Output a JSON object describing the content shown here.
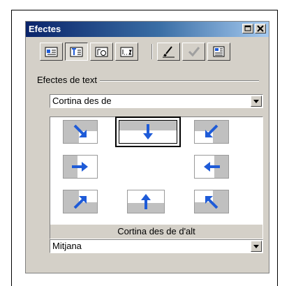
{
  "window": {
    "title": "Efectes"
  },
  "titlebar_buttons": [
    {
      "icon": "minimize-icon"
    },
    {
      "icon": "close-icon"
    }
  ],
  "toolbar": [
    {
      "icon": "slide-transition-icon",
      "pressed": false
    },
    {
      "icon": "text-effects-icon",
      "pressed": true
    },
    {
      "icon": "object-effects-icon",
      "pressed": false
    },
    {
      "icon": "order-icon",
      "pressed": false
    },
    {
      "icon": "preview-brush-icon",
      "pressed": false
    },
    {
      "icon": "apply-check-icon",
      "pressed": false
    },
    {
      "icon": "slideshow-icon",
      "pressed": false
    }
  ],
  "text_effects": {
    "group_label": "Efectes de text",
    "effect_type": "Cortina des de",
    "selected_caption": "Cortina des de d'alt",
    "speed": "Mitjana",
    "directions": [
      {
        "name": "top-left",
        "arrow_icon": "arrow-down-right-icon"
      },
      {
        "name": "top",
        "arrow_icon": "arrow-down-icon",
        "selected": true
      },
      {
        "name": "top-right",
        "arrow_icon": "arrow-down-left-icon"
      },
      {
        "name": "left",
        "arrow_icon": "arrow-right-icon"
      },
      {
        "name": "right",
        "arrow_icon": "arrow-left-icon"
      },
      {
        "name": "bottom-left",
        "arrow_icon": "arrow-up-right-icon"
      },
      {
        "name": "bottom",
        "arrow_icon": "arrow-up-icon"
      },
      {
        "name": "bottom-right",
        "arrow_icon": "arrow-up-left-icon"
      }
    ]
  },
  "colors": {
    "titlebar_start": "#0a246a",
    "titlebar_end": "#a6caf0",
    "face": "#d4d0c8",
    "arrow": "#1e5bd8",
    "shade": "#c0c0c0"
  }
}
